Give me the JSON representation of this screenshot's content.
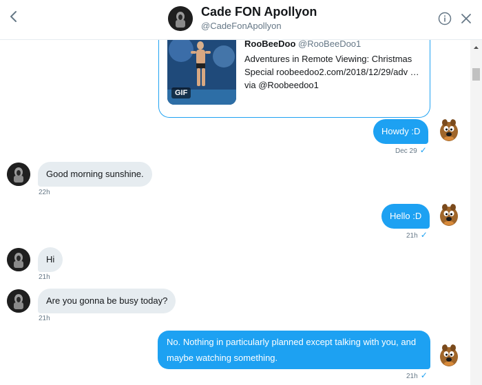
{
  "header": {
    "name": "Cade FON Apollyon",
    "handle": "@CadeFonApollyon",
    "back_icon": "chevron-left-icon",
    "info_icon": "info-icon",
    "close_icon": "close-icon"
  },
  "quote": {
    "author_name": "RooBeeDoo",
    "author_handle": "@RooBeeDoo1",
    "text": "Adventures in Remote Viewing: Christmas Special roobeedoo2.com/2018/12/29/adv … via @Roobeedoo1",
    "gif_label": "GIF"
  },
  "messages": [
    {
      "direction": "out",
      "text": "Howdy :D",
      "time": "Dec 29",
      "read": "✓"
    },
    {
      "direction": "in",
      "text": "Good morning sunshine.",
      "time": "22h"
    },
    {
      "direction": "out",
      "text": "Hello :D",
      "time": "21h",
      "read": "✓"
    },
    {
      "direction": "in",
      "text": "Hi",
      "time": "21h"
    },
    {
      "direction": "in",
      "text": "Are you gonna be busy today?",
      "time": "21h"
    },
    {
      "direction": "out",
      "text": "No. Nothing in particularly planned except talking with you, and maybe watching something.",
      "time": "21h",
      "read": "✓"
    }
  ],
  "colors": {
    "accent": "#1da1f2",
    "incoming_bubble": "#e6ecf0",
    "muted_text": "#657786"
  }
}
